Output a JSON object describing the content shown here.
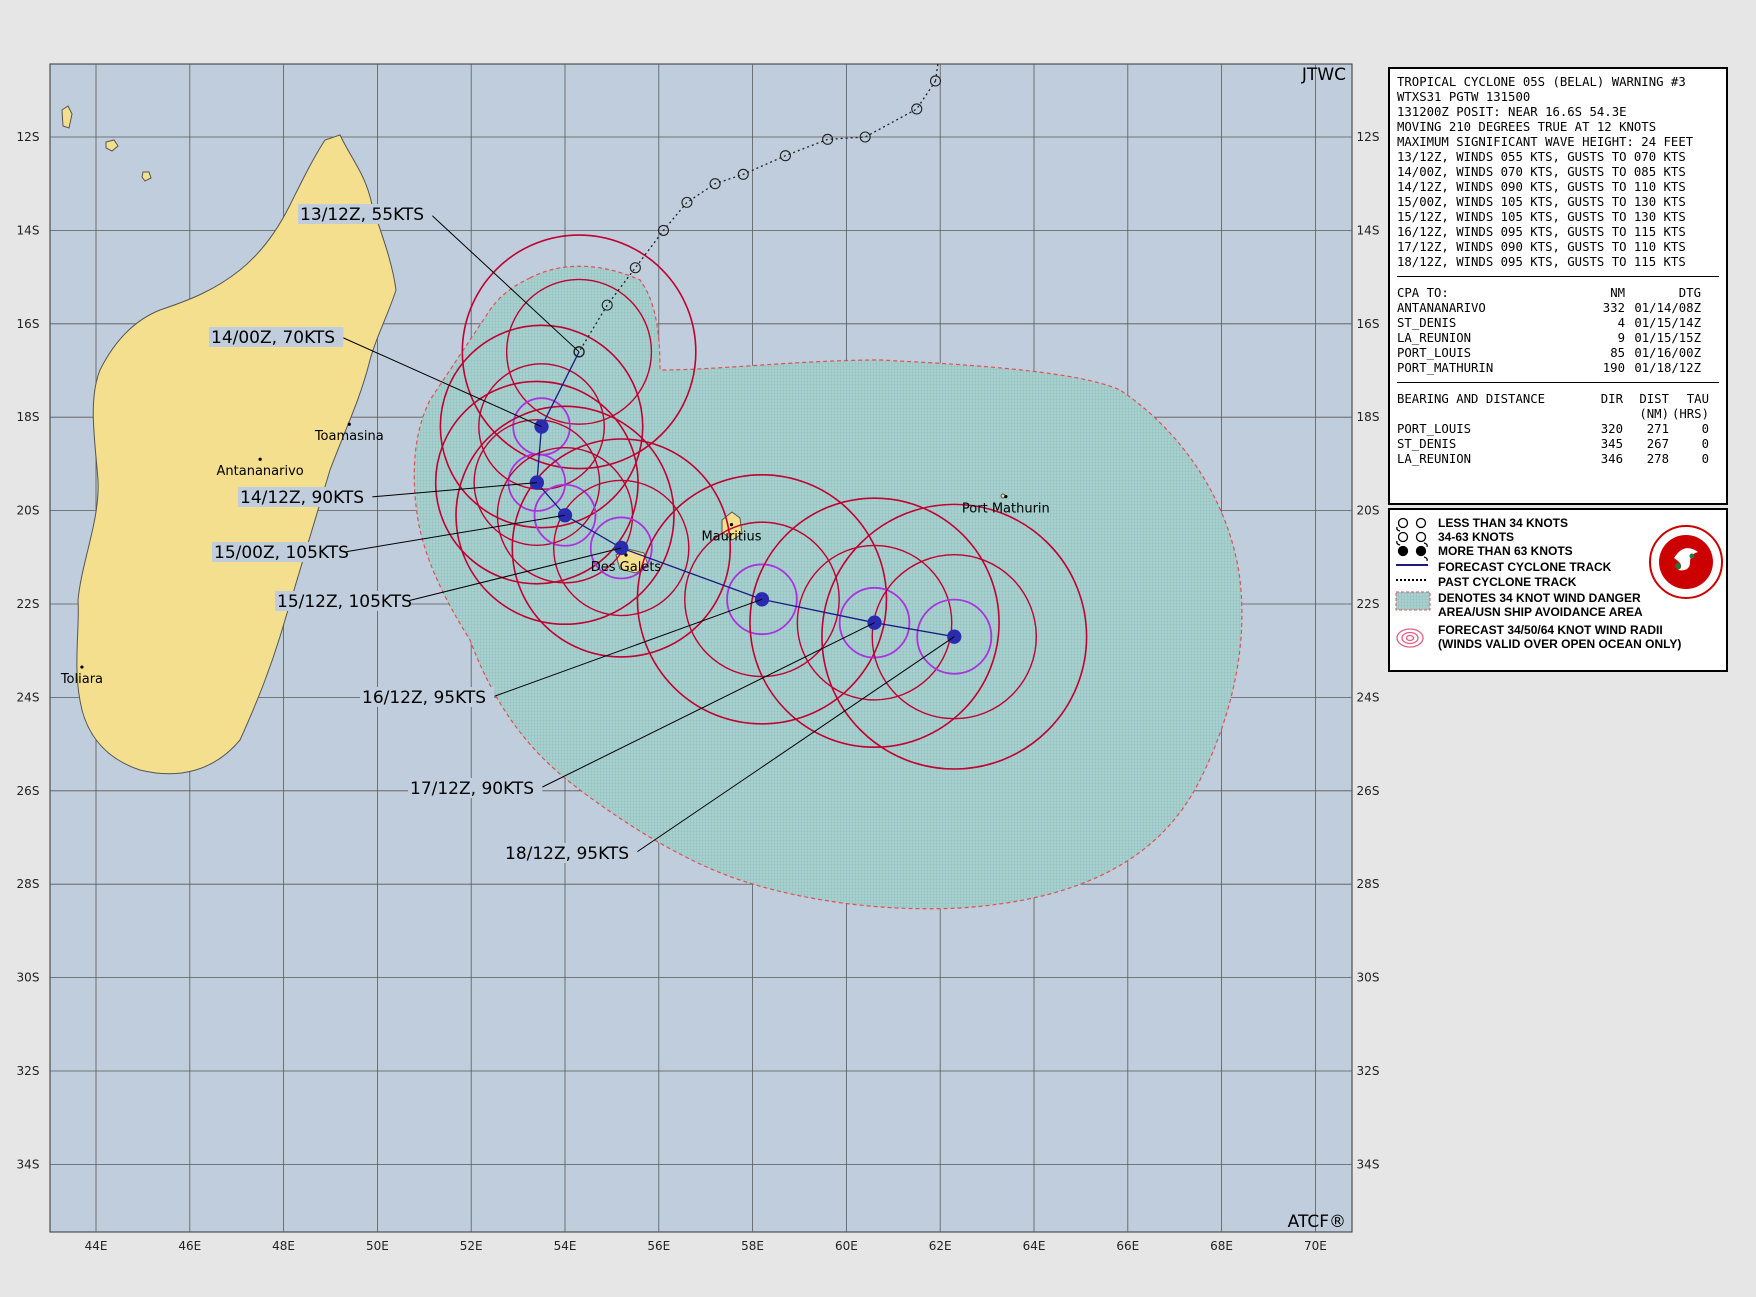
{
  "corner_labels": {
    "source": "JTWC",
    "system": "ATCF®"
  },
  "axes": {
    "lon_ticks": [
      "44E",
      "46E",
      "48E",
      "50E",
      "52E",
      "54E",
      "56E",
      "58E",
      "60E",
      "62E",
      "64E",
      "66E",
      "68E",
      "70E"
    ],
    "lat_ticks": [
      "12S",
      "14S",
      "16S",
      "18S",
      "20S",
      "22S",
      "24S",
      "26S",
      "28S",
      "30S",
      "32S",
      "34S"
    ]
  },
  "places": [
    {
      "name": "Toamasina",
      "lon": 49.4,
      "lat": -18.15
    },
    {
      "name": "Antananarivo",
      "lon": 47.5,
      "lat": -18.9
    },
    {
      "name": "Toliara",
      "lon": 43.7,
      "lat": -23.35
    },
    {
      "name": "Mauritius",
      "lon": 57.55,
      "lat": -20.3
    },
    {
      "name": "Des Galets",
      "lon": 55.3,
      "lat": -20.95
    },
    {
      "name": "Port Mathurin",
      "lon": 63.4,
      "lat": -19.7
    }
  ],
  "forecast_labels": [
    "13/12Z,  55KTS",
    "14/00Z,  70KTS",
    "14/12Z,  90KTS",
    "15/00Z, 105KTS",
    "15/12Z, 105KTS",
    "16/12Z,  95KTS",
    "17/12Z,  90KTS",
    "18/12Z,  95KTS"
  ],
  "forecast_track": [
    {
      "tau": "13/12Z",
      "lon": 54.3,
      "lat": -16.6,
      "kts": 55
    },
    {
      "tau": "14/00Z",
      "lon": 53.5,
      "lat": -18.2,
      "kts": 70
    },
    {
      "tau": "14/12Z",
      "lon": 53.4,
      "lat": -19.4,
      "kts": 90
    },
    {
      "tau": "15/00Z",
      "lon": 54.0,
      "lat": -20.1,
      "kts": 105
    },
    {
      "tau": "15/12Z",
      "lon": 55.2,
      "lat": -20.8,
      "kts": 105
    },
    {
      "tau": "16/12Z",
      "lon": 58.2,
      "lat": -21.9,
      "kts": 95
    },
    {
      "tau": "17/12Z",
      "lon": 60.6,
      "lat": -22.4,
      "kts": 90
    },
    {
      "tau": "18/12Z",
      "lon": 62.3,
      "lat": -22.7,
      "kts": 95
    }
  ],
  "past_track": [
    {
      "lon": 61.9,
      "lat": -10.8
    },
    {
      "lon": 61.5,
      "lat": -11.4
    },
    {
      "lon": 60.4,
      "lat": -12.0
    },
    {
      "lon": 59.6,
      "lat": -12.05
    },
    {
      "lon": 58.7,
      "lat": -12.4
    },
    {
      "lon": 57.8,
      "lat": -12.8
    },
    {
      "lon": 57.2,
      "lat": -13.0
    },
    {
      "lon": 56.6,
      "lat": -13.4
    },
    {
      "lon": 56.1,
      "lat": -14.0
    },
    {
      "lon": 55.5,
      "lat": -14.8
    },
    {
      "lon": 54.9,
      "lat": -15.6
    },
    {
      "lon": 54.3,
      "lat": -16.6
    }
  ],
  "warning": {
    "lines": [
      "TROPICAL CYCLONE 05S (BELAL) WARNING #3",
      "WTXS31 PGTW 131500",
      "131200Z POSIT: NEAR 16.6S 54.3E",
      "MOVING 210 DEGREES TRUE AT 12 KNOTS",
      "MAXIMUM SIGNIFICANT WAVE HEIGHT: 24 FEET",
      "13/12Z, WINDS 055 KTS, GUSTS TO 070 KTS",
      "14/00Z, WINDS 070 KTS, GUSTS TO 085 KTS",
      "14/12Z, WINDS 090 KTS, GUSTS TO 110 KTS",
      "15/00Z, WINDS 105 KTS, GUSTS TO 130 KTS",
      "15/12Z, WINDS 105 KTS, GUSTS TO 130 KTS",
      "16/12Z, WINDS 095 KTS, GUSTS TO 115 KTS",
      "17/12Z, WINDS 090 KTS, GUSTS TO 110 KTS",
      "18/12Z, WINDS 095 KTS, GUSTS TO 115 KTS"
    ],
    "cpa_header": [
      "CPA TO:",
      "NM",
      "DTG"
    ],
    "cpa": [
      [
        "ANTANANARIVO",
        "332",
        "01/14/08Z"
      ],
      [
        "ST_DENIS",
        "4",
        "01/15/14Z"
      ],
      [
        "LA_REUNION",
        "9",
        "01/15/15Z"
      ],
      [
        "PORT_LOUIS",
        "85",
        "01/16/00Z"
      ],
      [
        "PORT_MATHURIN",
        "190",
        "01/18/12Z"
      ]
    ],
    "bd_header": [
      "BEARING AND DISTANCE",
      "DIR",
      "DIST",
      "TAU"
    ],
    "bd_header2": [
      "",
      "",
      "(NM)",
      "(HRS)"
    ],
    "bd": [
      [
        "PORT_LOUIS",
        "320",
        "271",
        "0"
      ],
      [
        "ST_DENIS",
        "345",
        "267",
        "0"
      ],
      [
        "LA_REUNION",
        "346",
        "278",
        "0"
      ]
    ]
  },
  "legend": {
    "items": [
      "LESS THAN 34 KNOTS",
      "34-63 KNOTS",
      "MORE THAN 63 KNOTS",
      "FORECAST CYCLONE TRACK",
      "PAST CYCLONE TRACK",
      "DENOTES 34 KNOT WIND DANGER\nAREA/USN SHIP AVOIDANCE AREA",
      "FORECAST 34/50/64 KNOT WIND RADII\n(WINDS VALID OVER OPEN OCEAN ONLY)"
    ]
  },
  "colors": {
    "ocean": "#bfcddc",
    "land": "#f3df8e",
    "danger_fill": "#a8d0cf",
    "radii_34": "#c00030",
    "radii_64": "#aa33dd",
    "storm_center": "#2b2bb0",
    "grid": "#5a5a5a"
  }
}
